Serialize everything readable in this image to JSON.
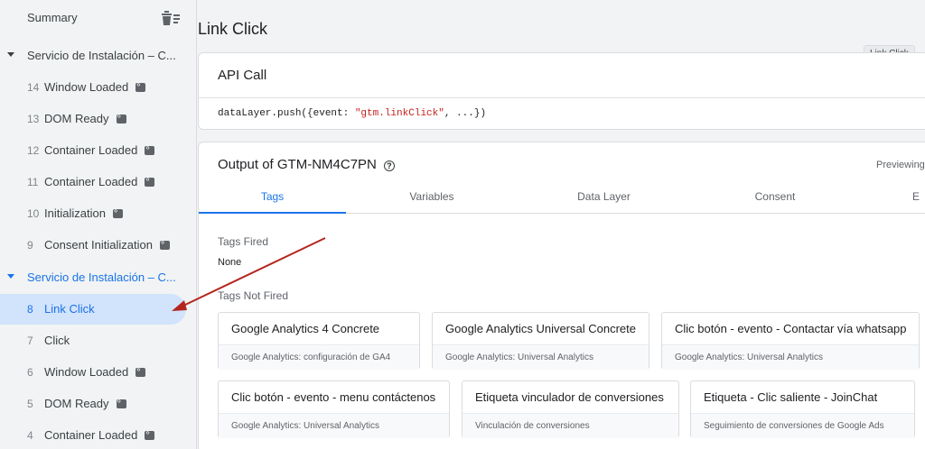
{
  "sidebar": {
    "summary_label": "Summary",
    "delete_icon": "delete-list-icon",
    "groups": [
      {
        "label": "Servicio de Instalación – C...",
        "active": false
      },
      {
        "label": "Servicio de Instalación – C...",
        "active": true
      }
    ],
    "events_group1": [
      {
        "num": "14",
        "label": "Window Loaded",
        "badge": true
      },
      {
        "num": "13",
        "label": "DOM Ready",
        "badge": true
      },
      {
        "num": "12",
        "label": "Container Loaded",
        "badge": true
      },
      {
        "num": "11",
        "label": "Container Loaded",
        "badge": true
      },
      {
        "num": "10",
        "label": "Initialization",
        "badge": true
      },
      {
        "num": "9",
        "label": "Consent Initialization",
        "badge": true
      }
    ],
    "events_group2": [
      {
        "num": "8",
        "label": "Link Click",
        "badge": false,
        "selected": true
      },
      {
        "num": "7",
        "label": "Click",
        "badge": false
      },
      {
        "num": "6",
        "label": "Window Loaded",
        "badge": true
      },
      {
        "num": "5",
        "label": "DOM Ready",
        "badge": true
      },
      {
        "num": "4",
        "label": "Container Loaded",
        "badge": true
      }
    ]
  },
  "main": {
    "page_title": "Link Click",
    "tooltip": "Link Click",
    "api_call": {
      "title": "API Call",
      "code_prefix": "dataLayer.push({event: ",
      "code_string": "\"gtm.linkClick\"",
      "code_suffix": ", ...})"
    },
    "output": {
      "title": "Output of GTM-NM4C7PN",
      "previewing": "Previewing",
      "tabs": [
        "Tags",
        "Variables",
        "Data Layer",
        "Consent",
        "E"
      ],
      "active_tab": "Tags",
      "tags_fired_heading": "Tags Fired",
      "tags_fired_value": "None",
      "tags_not_fired_heading": "Tags Not Fired",
      "tags_not_fired": [
        {
          "name": "Google Analytics 4 Concrete",
          "type": "Google Analytics: configuración de GA4"
        },
        {
          "name": "Google Analytics Universal Concrete",
          "type": "Google Analytics: Universal Analytics"
        },
        {
          "name": "Clic botón - evento - Contactar vía whatsapp",
          "type": "Google Analytics: Universal Analytics"
        },
        {
          "name": "Clic botón - evento - menu contáctenos",
          "type": "Google Analytics: Universal Analytics"
        },
        {
          "name": "Etiqueta vinculador de conversiones",
          "type": "Vinculación de conversiones"
        },
        {
          "name": "Etiqueta - Clic saliente - JoinChat",
          "type": "Seguimiento de conversiones de Google Ads"
        }
      ]
    }
  },
  "colors": {
    "accent": "#1a73e8",
    "selected_bg": "#d2e3fc",
    "arrow": "#b3261e",
    "code_string": "#c5221f"
  }
}
